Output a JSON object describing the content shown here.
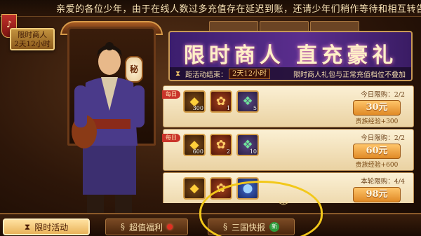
{
  "marquee": {
    "text": "亲爱的各位少年，由于在线人数过多充值存在延迟到账，还请少年们稍作等待和相互转告",
    "icon": "horn-icon"
  },
  "timer_badge": {
    "line1": "限时商人",
    "line2": "2天12小时"
  },
  "lantern_char": "秘",
  "banner": {
    "title": "限时商人 直充豪礼",
    "countdown_label": "距活动结束：",
    "countdown_value": "2天12小时",
    "note": "限时商人礼包与正常充值档位不叠加"
  },
  "offers": [
    {
      "tag": "每日",
      "items": [
        {
          "icon": "gold-ingot-icon",
          "count": "300",
          "type": "gold"
        },
        {
          "icon": "scroll-bag-icon",
          "count": "1",
          "type": "scroll"
        },
        {
          "icon": "jade-token-icon",
          "count": "5",
          "type": "jade"
        }
      ],
      "limit": "今日限购：2/2",
      "price": "30元",
      "bonus": "贵族经验+300"
    },
    {
      "tag": "每日",
      "items": [
        {
          "icon": "gold-ingot-icon",
          "count": "600",
          "type": "gold"
        },
        {
          "icon": "scroll-bag-icon",
          "count": "2",
          "type": "scroll"
        },
        {
          "icon": "jade-token-icon",
          "count": "10",
          "type": "jade"
        }
      ],
      "limit": "今日限购：2/2",
      "price": "60元",
      "bonus": "贵族经验+600"
    },
    {
      "tag": "",
      "items": [
        {
          "icon": "gold-ingot-icon",
          "count": "",
          "type": "gold"
        },
        {
          "icon": "scroll-bag-icon",
          "count": "",
          "type": "scroll"
        },
        {
          "icon": "blue-orb-icon",
          "count": "",
          "type": "orb"
        }
      ],
      "limit": "本轮限购：4/4",
      "price": "98元",
      "bonus": ""
    }
  ],
  "bottom_nav": [
    {
      "label": "限时活动",
      "active": true,
      "icon": "hourglass-icon"
    },
    {
      "label": "超值福利",
      "active": false,
      "icon": "swirl-icon",
      "badge": "red"
    },
    {
      "label": "三国快报",
      "active": false,
      "icon": "swirl-icon",
      "badge": "新"
    }
  ],
  "colors": {
    "accent": "#e9b35a",
    "banner": "#5b2e8e",
    "price": "#e08a26",
    "highlight_circle": "#f2c81a"
  }
}
